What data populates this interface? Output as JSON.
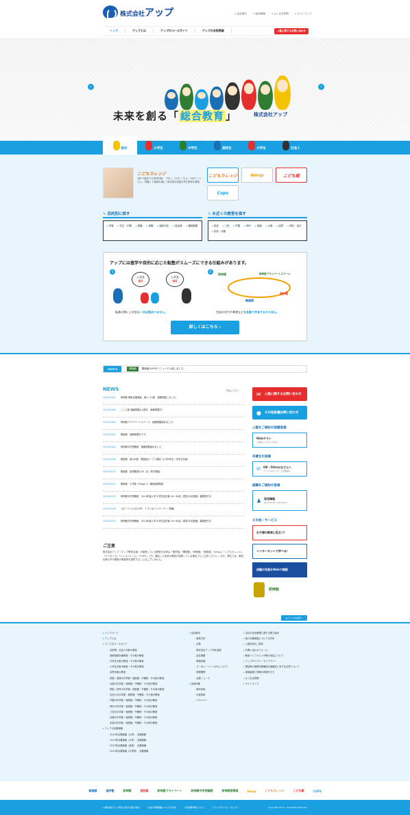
{
  "header": {
    "logo_prefix": "株式会社",
    "logo_main": "アップ",
    "util_links": [
      "会社案内",
      "採用情報",
      "よくある質問",
      "サイトマップ"
    ],
    "nav": [
      "トップ",
      "アップとは",
      "アップのコースガイド",
      "アップの合格実績"
    ],
    "cta": "入塾に関するお問い合わせ"
  },
  "hero": {
    "catch_pre": "未来を創る「",
    "catch_em": "総合教育",
    "catch_post": "」",
    "logo": "株式会社アップ"
  },
  "tabs": [
    "総合",
    "小学生",
    "中学生",
    "高校生",
    "大学生",
    "社会人"
  ],
  "intro": {
    "title": "こどもカレッジ",
    "text": "2歳〜6歳までの幼児対象。「めじ」「カザ」「ちえ」「ほけ」「リズム」「運動」の指導を通じて総合型な知能を育む教育を実践。"
  },
  "banners": [
    "こどもカレッジ",
    "Amup",
    "こども館",
    "Cups"
  ],
  "purpose": {
    "title": "目的別に探す",
    "links": [
      "学習",
      "先生・中間",
      "受験",
      "体験",
      "個別対応",
      "各会館",
      "講師募集"
    ]
  },
  "area": {
    "title": "お近くの教室を探す",
    "links": [
      "西宮",
      "三田",
      "芦屋",
      "神戸",
      "西脇",
      "大阪",
      "滋賀",
      "明石・加古",
      "奈良・京都"
    ]
  },
  "system": {
    "title": "アップには進学や目的に応じた転塾がスムーズにできる仕組みがあります。",
    "n1": "1",
    "n2": "2",
    "bubble1": "入学金",
    "bubble1v": "0円",
    "bubble2": "入学金",
    "bubble2v": "0円",
    "cap1_pre": "転塾の際に入学金は",
    "cap1_em": "一切必要ありません。",
    "cap2_pre": "生徒の学力や希望などを",
    "cap2_em": "各塾で共有するから安心。",
    "lbl_a": "研伸館",
    "lbl_b": "研伸館プライベートスクール",
    "lbl_c": "開進館",
    "lbl_d": "個別館",
    "button": "詳しくはこちら ›"
  },
  "topics": {
    "label": "TOPICS",
    "tag": "開進館",
    "text": "開進館のHPがリニューアル致しました。"
  },
  "news": {
    "title": "NEWS",
    "more": "一覧はこちら ›",
    "items": [
      {
        "d": "2013/03/01",
        "t": "研伸館 現役合格実績　第1〜15回　速報掲載しました！"
      },
      {
        "d": "2013/03/01",
        "t": "ここに新 速報掲載&公開中　速報掲載中！"
      },
      {
        "d": "2013/03/01",
        "t": "研伸館プライベートスクール　速報掲載始めました！"
      },
      {
        "d": "2013/03/01",
        "t": "開進館　速報掲載中です！"
      },
      {
        "d": "2013/03/01",
        "t": "研伸館中学受験館　速報掲載始めました"
      },
      {
        "d": "2013/02/28",
        "t": "開進館　第165回　開進館オープン模試（小学5年生〜中学生対象）"
      },
      {
        "d": "2013/02/25",
        "t": "開進館　新規開講5/26（日）受付開始！"
      },
      {
        "d": "2013/02/21",
        "t": "開進館　小学部（Stage 1）通信講座開講"
      },
      {
        "d": "2013/02/20",
        "t": "研伸館中学受験館　2014年度入学 中学生徒対象 10〜80名（限定30名程度）募集受付中"
      },
      {
        "d": "2013/02/18",
        "t": "スポーツジム＆CUPS　トランポリンパーティー開催"
      },
      {
        "d": "2013/02/15",
        "t": "研伸館中学受験館　2014年度入学 中学生徒対象 10〜80名（限定30名程度）募集受付中"
      }
    ]
  },
  "notice": {
    "title": "ご注意",
    "text": "株式会社アップ（アップ教育企画）が運営している教室の名称は「進学塾」「開進館」「研伸館」「個別館」「Amup」「こどもカレッジ」「ナイセンス」「レッスンルーム」「CUPS」です。類似した名称の教室が運営している場合でもご注意ください。なお、弊社では、教室名称以外の看板や販促物を提供することはございません。"
  },
  "side": {
    "contact": "入塾に関するお問い合わせ",
    "other": "その他各種お問い合わせ",
    "h1": "入塾をご検討の保護者様",
    "web": "Webチラシ",
    "web_s": "ご覧頂くことができます",
    "h2": "卒業生の皆様",
    "obog": "OB・OGのみなさんへ",
    "obog_s": "アップへのメッセージを募集中",
    "h3": "就職をご検討の皆様",
    "recruit": "採用情報",
    "recruit_s": "Recruitment information",
    "h4": "その他・サービス",
    "s1": "お子様の教育に役立つ！",
    "s2": "インターネットで学べる！",
    "s3": "成績の写真をWebで確認",
    "partner": "研伸館"
  },
  "pagetop": "▲ ページの先頭へ",
  "footer": {
    "col1": [
      {
        "c": "l1",
        "t": "トップページ"
      },
      {
        "c": "l1",
        "t": "アップとは"
      },
      {
        "c": "l1",
        "t": "アップのコースガイド"
      },
      {
        "c": "l2",
        "t": "幼児等・社会人対象の教室"
      },
      {
        "c": "l2",
        "t": "個別指導対象教室・その他の教室"
      },
      {
        "c": "l2",
        "t": "中学生対象の教室・その他の教室"
      },
      {
        "c": "l2",
        "t": "小学生対象の教室・その他の教室"
      },
      {
        "c": "l2",
        "t": "幼児対象の教室"
      },
      {
        "c": "l2",
        "t": "西宮・宝塚の中学部・個別館・予備校・その他の教室"
      },
      {
        "c": "l2",
        "t": "大阪の中学部・個別館・予備校・その他の教室"
      },
      {
        "c": "l2",
        "t": "明石・伊丹の中学部・個別館・予備校・その他の教室"
      },
      {
        "c": "l2",
        "t": "加古川の中学部・個別館・予備校・その他の教室"
      },
      {
        "c": "l2",
        "t": "芦屋の中学部・個別館・予備校・その他の教室"
      },
      {
        "c": "l2",
        "t": "神戸の中学部・個別館・予備校・その他の教室"
      },
      {
        "c": "l2",
        "t": "三田の中学部・個別館・予備校・その他の教室"
      },
      {
        "c": "l2",
        "t": "京都の中学部・個別館・予備校・その他の教室"
      },
      {
        "c": "l2",
        "t": "奈良の中学部・個別館・予備校・その他の教室"
      },
      {
        "c": "l1",
        "t": "アップの合格実績"
      },
      {
        "c": "l2",
        "t": "2013年合格実績（大学）　合格実績"
      },
      {
        "c": "l2",
        "t": "2013年合格実績（大学）　合格実績"
      },
      {
        "c": "l2",
        "t": "2013年合格実績（高校）　合格実績"
      },
      {
        "c": "l2",
        "t": "2013年合格実績（中学校）　合格実績"
      }
    ],
    "col2": [
      {
        "c": "l1",
        "t": "会社案内"
      },
      {
        "c": "l2",
        "t": "経営方針"
      },
      {
        "c": "l2",
        "t": "沿革"
      },
      {
        "c": "l2",
        "t": "株式会社アップ本社地図"
      },
      {
        "c": "l2",
        "t": "会社概要"
      },
      {
        "c": "l2",
        "t": "株価情報"
      },
      {
        "c": "l2",
        "t": "コーポレートシンボルについて"
      },
      {
        "c": "l2",
        "t": "事業開発"
      },
      {
        "c": "l2",
        "t": "企業ニュース"
      },
      {
        "c": "l1",
        "t": "採用情報"
      },
      {
        "c": "l2",
        "t": "新卒採用"
      },
      {
        "c": "l2",
        "t": "中途採用"
      },
      {
        "c": "l2",
        "t": "アルバイト"
      }
    ],
    "col3": [
      {
        "c": "l1",
        "t": "当社の安全管理に関する取り組み"
      },
      {
        "c": "l1",
        "t": "個人情報保護についての方針"
      },
      {
        "c": "l1",
        "t": "入塾状況のご案内"
      },
      {
        "c": "l1",
        "t": "お問い合わせフォーム"
      },
      {
        "c": "l1",
        "t": "教室インフルエンザ等の対応について"
      },
      {
        "c": "l1",
        "t": "アップギャラリーライブラリー"
      },
      {
        "c": "l1",
        "t": "電話等の授業料等確認の連絡先に対する注意について"
      },
      {
        "c": "l1",
        "t": "保護者様と同様の体制をもち"
      },
      {
        "c": "l1",
        "t": "よくある質問"
      },
      {
        "c": "l1",
        "t": "サイトマップ"
      }
    ]
  },
  "brands": [
    "開進館",
    "進学塾",
    "研伸館",
    "個別館",
    "研伸館プライベート",
    "研伸館中学受験館",
    "研伸館高等部",
    "Amup",
    "こどもカレッジ",
    "こども館",
    "CUPS"
  ],
  "bottom": [
    "▸ 株式会社アップ安全に関する取り組み",
    "▸ 個人情報保護についての方針",
    "▸ 音楽著作権について",
    "▸ アップギャラリーセンター"
  ],
  "copyright": "Copyright UP Inc. All Rights Reserved."
}
